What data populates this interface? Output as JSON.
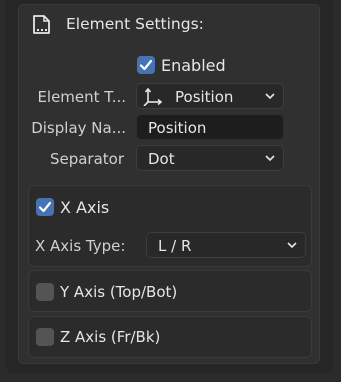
{
  "header": {
    "title": "Element Settings:",
    "icon": "panel-icon"
  },
  "enabled": {
    "label": "Enabled",
    "checked": true
  },
  "element_type": {
    "label": "Element T...",
    "value": "Position",
    "icon": "axis-transform-icon"
  },
  "display_name": {
    "label": "Display Na...",
    "value": "Position"
  },
  "separator": {
    "label": "Separator",
    "value": "Dot"
  },
  "x_axis": {
    "label": "X Axis",
    "checked": true,
    "type_label": "X Axis Type:",
    "type_value": "L / R"
  },
  "y_axis": {
    "label": "Y Axis (Top/Bot)",
    "checked": false
  },
  "z_axis": {
    "label": "Z Axis (Fr/Bk)",
    "checked": false
  },
  "colors": {
    "accent": "#4772b3",
    "panel": "#303030",
    "field": "#282828",
    "field_dark": "#1d1d1d"
  }
}
